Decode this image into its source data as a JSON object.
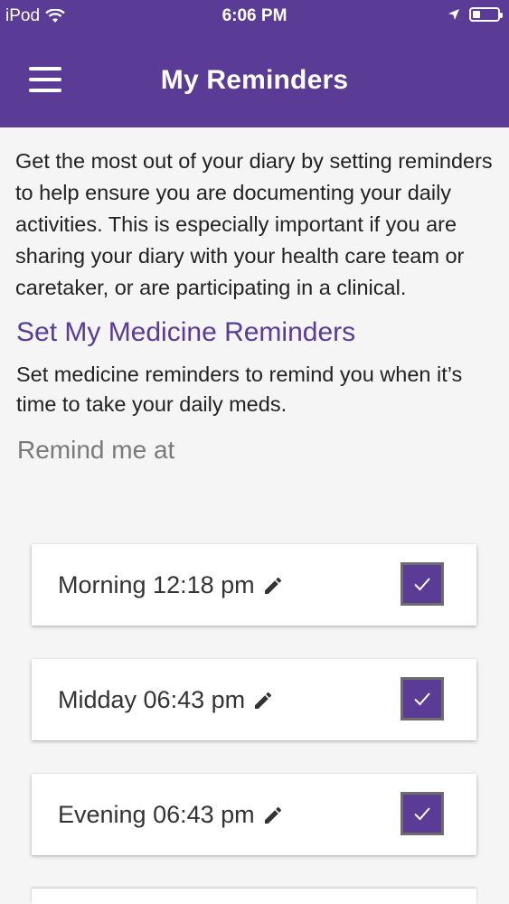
{
  "status_bar": {
    "carrier": "iPod",
    "time": "6:06 PM",
    "wifi_icon": "wifi-icon",
    "location_icon": "location-arrow-icon",
    "battery_level": 0.3
  },
  "app_bar": {
    "title": "My Reminders",
    "menu_icon": "hamburger-menu-icon"
  },
  "intro_text": "Get the most out of your diary by setting reminders to help ensure you are documenting your daily activities. This is especially important if you are sharing your diary with your health care team or caretaker, or are participating in a clinical.",
  "medicine_section": {
    "title": "Set My Medicine Reminders",
    "description": "Set medicine reminders to remind you when it’s time to take your daily meds.",
    "remind_label": "Remind me at"
  },
  "reminders": [
    {
      "name": "Morning",
      "time": "12:18 pm",
      "label": "Morning 12:18 pm",
      "checked": true
    },
    {
      "name": "Midday",
      "time": "06:43 pm",
      "label": "Midday 06:43 pm",
      "checked": true
    },
    {
      "name": "Evening",
      "time": "06:43 pm",
      "label": "Evening 06:43 pm",
      "checked": true
    }
  ],
  "colors": {
    "brand_purple": "#5a3b96",
    "background": "#f5f5f5",
    "checkbox_border": "#6d6d6d"
  }
}
